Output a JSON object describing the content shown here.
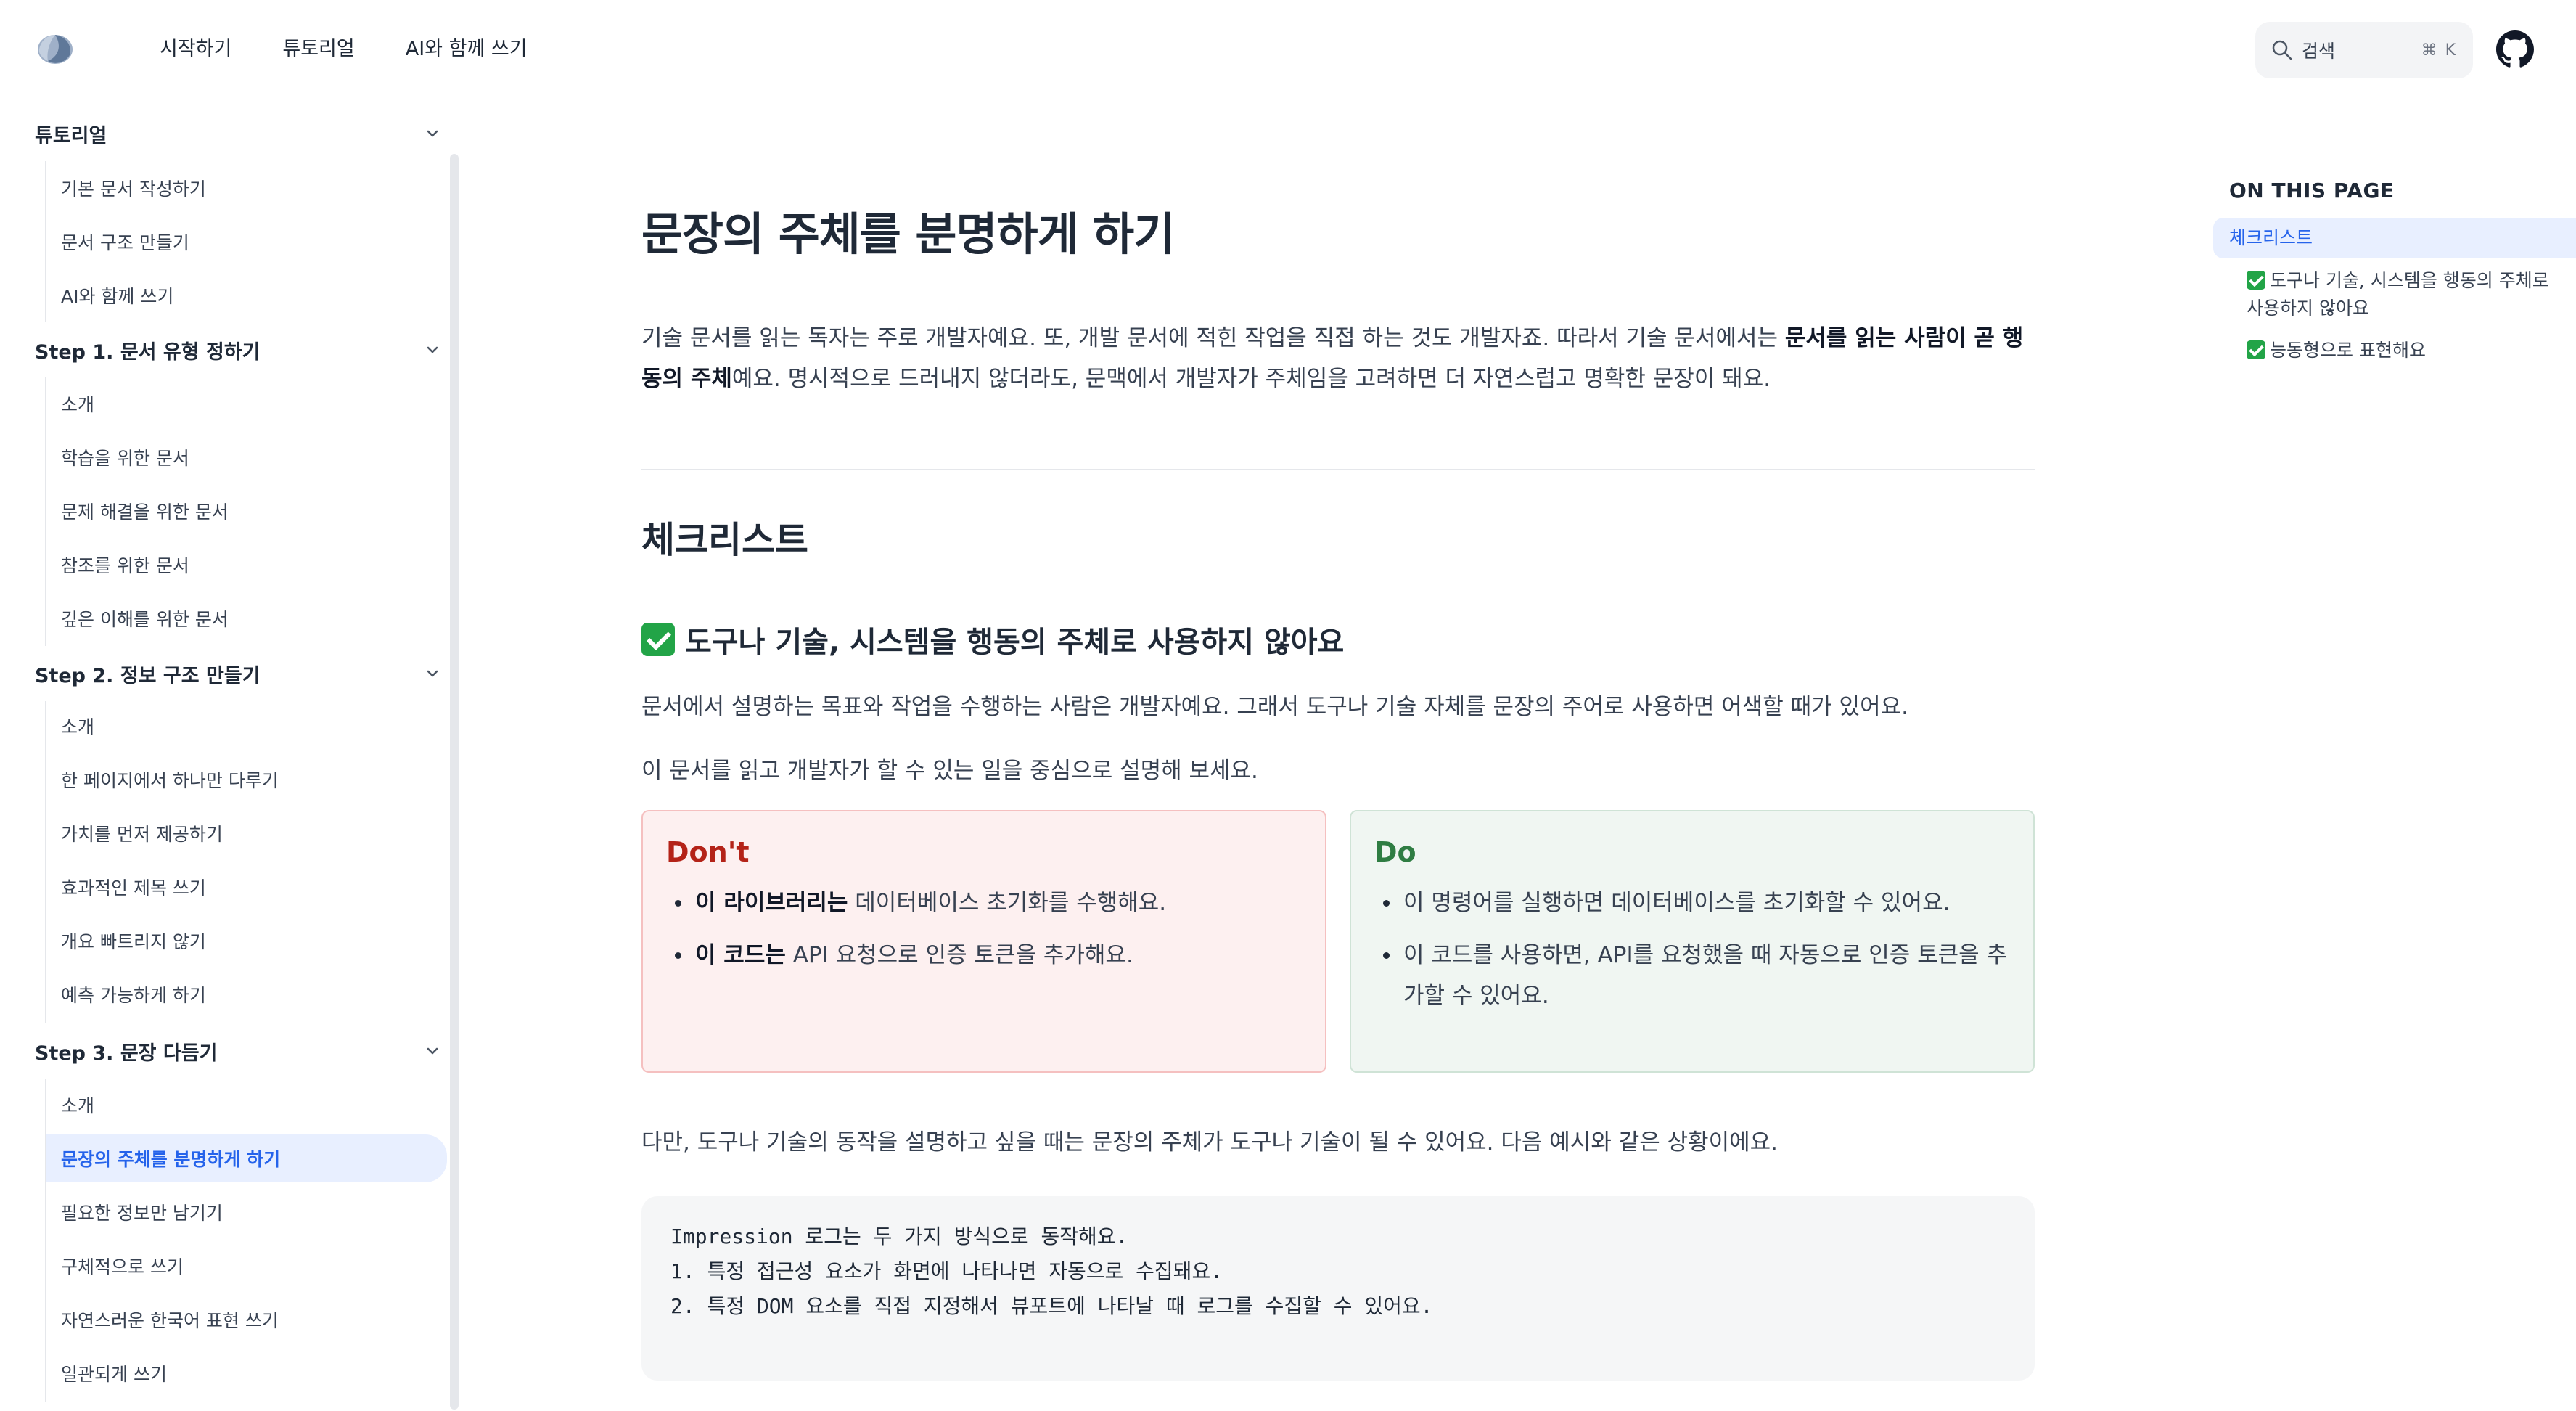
{
  "header": {
    "nav": [
      "시작하기",
      "튜토리얼",
      "AI와 함께 쓰기"
    ],
    "search_label": "검색",
    "search_shortcut": "⌘ K"
  },
  "sidebar": {
    "groups": [
      {
        "title": "튜토리얼",
        "items": [
          "기본 문서 작성하기",
          "문서 구조 만들기",
          "AI와 함께 쓰기"
        ]
      },
      {
        "title": "Step 1. 문서 유형 정하기",
        "items": [
          "소개",
          "학습을 위한 문서",
          "문제 해결을 위한 문서",
          "참조를 위한 문서",
          "깊은 이해를 위한 문서"
        ]
      },
      {
        "title": "Step 2. 정보 구조 만들기",
        "items": [
          "소개",
          "한 페이지에서 하나만 다루기",
          "가치를 먼저 제공하기",
          "효과적인 제목 쓰기",
          "개요 빠트리지 않기",
          "예측 가능하게 하기"
        ]
      },
      {
        "title": "Step 3. 문장 다듬기",
        "items": [
          "소개",
          "문장의 주체를 분명하게 하기",
          "필요한 정보만 남기기",
          "구체적으로 쓰기",
          "자연스러운 한국어 표현 쓰기",
          "일관되게 쓰기"
        ]
      }
    ],
    "active_item": "문장의 주체를 분명하게 하기"
  },
  "main": {
    "title": "문장의 주체를 분명하게 하기",
    "lead_part1": "기술 문서를 읽는 독자는 주로 개발자예요. 또, 개발 문서에 적힌 작업을 직접 하는 것도 개발자죠. 따라서 기술 문서에서는 ",
    "lead_bold": "문서를 읽는 사람이 곧 행동의 주체",
    "lead_part2": "예요. 명시적으로 드러내지 않더라도, 문맥에서 개발자가 주체임을 고려하면 더 자연스럽고 명확한 문장이 돼요.",
    "section_title": "체크리스트",
    "check_title": "도구나 기술, 시스템을 행동의 주체로 사용하지 않아요",
    "para1": "문서에서 설명하는 목표와 작업을 수행하는 사람은 개발자예요. 그래서 도구나 기술 자체를 문장의 주어로 사용하면 어색할 때가 있어요.",
    "para2": "이 문서를 읽고 개발자가 할 수 있는 일을 중심으로 설명해 보세요.",
    "dont": {
      "title": "Don't",
      "items": [
        {
          "bold": "이 라이브러리는",
          "text": " 데이터베이스 초기화를 수행해요."
        },
        {
          "bold": "이 코드는",
          "text": " API 요청으로 인증 토큰을 추가해요."
        }
      ]
    },
    "do": {
      "title": "Do",
      "items": [
        "이 명령어를 실행하면 데이터베이스를 초기화할 수 있어요.",
        "이 코드를 사용하면, API를 요청했을 때 자동으로 인증 토큰을 추가할 수 있어요."
      ]
    },
    "para3": "다만, 도구나 기술의 동작을 설명하고 싶을 때는 문장의 주체가 도구나 기술이 될 수 있어요. 다음 예시와 같은 상황이에요.",
    "code_lines": [
      "Impression 로그는 두 가지 방식으로 동작해요.",
      "",
      "1. 특정 접근성 요소가 화면에 나타나면 자동으로 수집돼요.",
      "2. 특정 DOM 요소를 직접 지정해서 뷰포트에 나타날 때 로그를 수집할 수 있어요."
    ]
  },
  "toc": {
    "heading": "ON THIS PAGE",
    "items": [
      "체크리스트",
      "도구나 기술, 시스템을 행동의 주체로 사용하지 않아요",
      "능동형으로 표현해요"
    ]
  },
  "colors": {
    "accent": "#2563eb",
    "active_bg": "#e8efff",
    "dont_title": "#b42318",
    "do_title": "#2f7d43",
    "check_green": "#22a447"
  }
}
